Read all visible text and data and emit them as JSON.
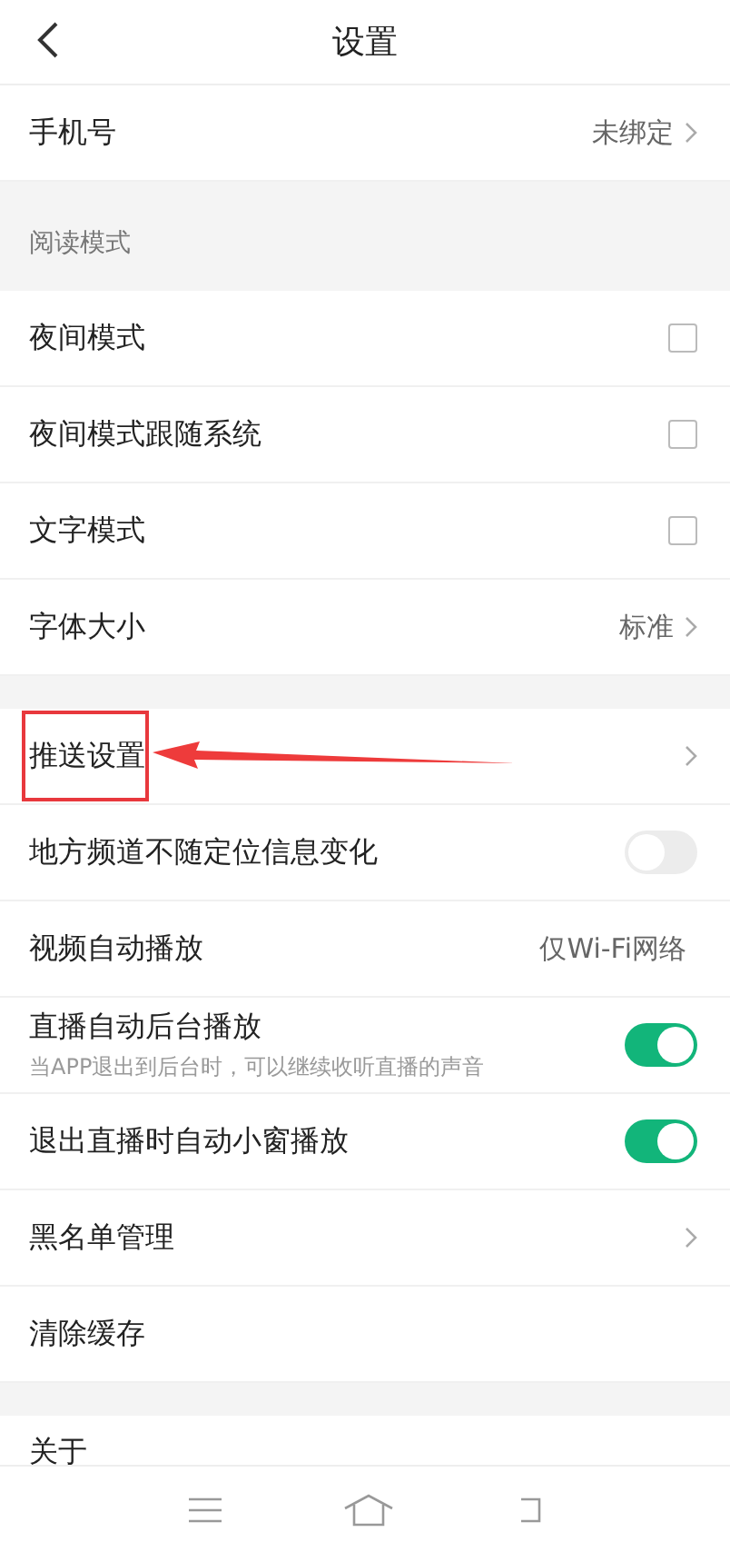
{
  "header": {
    "title": "设置"
  },
  "groups": [
    {
      "items": [
        {
          "kind": "link",
          "label": "手机号",
          "value": "未绑定"
        }
      ]
    },
    {
      "heading": "阅读模式",
      "items": [
        {
          "kind": "checkbox",
          "label": "夜间模式",
          "checked": false
        },
        {
          "kind": "checkbox",
          "label": "夜间模式跟随系统",
          "checked": false
        },
        {
          "kind": "checkbox",
          "label": "文字模式",
          "checked": false
        },
        {
          "kind": "link",
          "label": "字体大小",
          "value": "标准"
        }
      ]
    },
    {
      "items": [
        {
          "kind": "link",
          "label": "推送设置",
          "highlighted": true
        },
        {
          "kind": "toggle",
          "label": "地方频道不随定位信息变化",
          "on": false
        },
        {
          "kind": "value",
          "label": "视频自动播放",
          "value": "仅Wi-Fi网络"
        },
        {
          "kind": "toggle",
          "label": "直播自动后台播放",
          "sub": "当APP退出到后台时，可以继续收听直播的声音",
          "on": true
        },
        {
          "kind": "toggle",
          "label": "退出直播时自动小窗播放",
          "on": true
        },
        {
          "kind": "link",
          "label": "黑名单管理"
        },
        {
          "kind": "plain",
          "label": "清除缓存"
        }
      ]
    },
    {
      "items": [
        {
          "kind": "cut",
          "label": "关于"
        }
      ]
    }
  ]
}
